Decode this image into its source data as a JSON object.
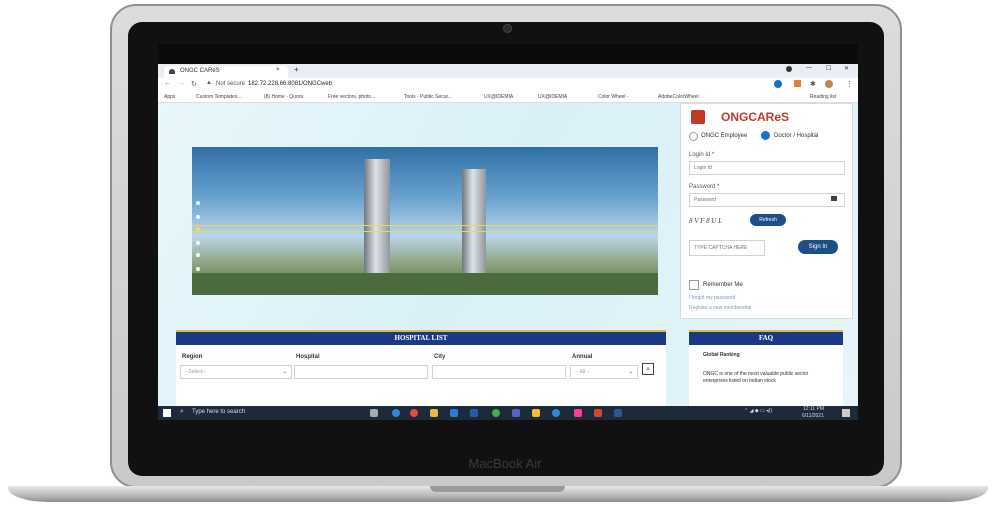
{
  "laptop": {
    "brand": "MacBook Air"
  },
  "browser": {
    "tab_title": "ONGC CAReS",
    "tab_close": "×",
    "new_tab": "+",
    "window_controls": [
      "—",
      "☐",
      "✕"
    ],
    "security": "Not secure",
    "url": "182.72.228.66:8081/ONGCweb",
    "bookmarks": [
      "Apps",
      "Custom Templates...",
      "(8) Home - Quora",
      "Free vectors, photo...",
      "Tools - Public Secur...",
      "UX@IDEMIA",
      "UX@IDEMIA",
      "Color Wheel -",
      "AdobeColorWheel"
    ],
    "reading_list": "Reading list"
  },
  "login": {
    "logo_text": "ONGCAReS",
    "role_employee": "ONGC Employee",
    "role_doctor": "Doctor / Hospital",
    "login_id_label": "Login Id *",
    "login_id_placeholder": "Login Id",
    "password_label": "Password *",
    "password_placeholder": "Password",
    "captcha_text": "8 V F 8 U L",
    "refresh": "Refresh",
    "captcha_placeholder": "TYPE CAPTCHA HERE",
    "sign_in": "Sign In",
    "remember_me": "Remember Me",
    "forgot": "I forgot my password",
    "register": "Register a new membership"
  },
  "hospital_list": {
    "title": "HOSPITAL LIST",
    "col_region": "Region",
    "col_hospital": "Hospital",
    "col_city": "City",
    "col_annual": "Annual",
    "region_value": "--Select--",
    "annual_value": "-- All --"
  },
  "faq": {
    "title": "FAQ",
    "item_title": "Global Ranking",
    "item_text": "ONGC is one of the most valuable public sector enterprises listed on Indian stock"
  },
  "taskbar": {
    "search_placeholder": "Type here to search",
    "time": "12:11 PM",
    "date": "6/11/2021"
  },
  "colors": {
    "accent": "#1a3a86",
    "brand_red": "#c0392b",
    "gold": "#e3b64c"
  }
}
